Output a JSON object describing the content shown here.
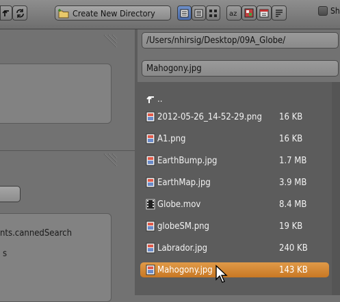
{
  "toolbar": {
    "create_dir_label": "Create New Directory",
    "show_label": "Sh",
    "icons": [
      "parent-dir-icon",
      "refresh-icon",
      "folder-new-icon",
      "short-list-icon",
      "long-list-icon",
      "thumbnail-icon",
      "sort-alpha-icon",
      "sort-ext-icon",
      "sort-time-icon",
      "sort-size-icon"
    ]
  },
  "left": {
    "search_text": "nts.cannedSearch",
    "search_text2": "s"
  },
  "path": {
    "directory": "/Users/nhirsig/Desktop/09A_Globe/",
    "filename": "Mahogony.jpg"
  },
  "files": {
    "parent_label": "..",
    "items": [
      {
        "name": "2012-05-26_14-52-29.png",
        "size": "16 KB",
        "type": "image"
      },
      {
        "name": "A1.png",
        "size": "16 KB",
        "type": "image"
      },
      {
        "name": "EarthBump.jpg",
        "size": "1.7 MB",
        "type": "image"
      },
      {
        "name": "EarthMap.jpg",
        "size": "3.9 MB",
        "type": "image"
      },
      {
        "name": "Globe.mov",
        "size": "8.4 MB",
        "type": "movie"
      },
      {
        "name": "globeSM.png",
        "size": "19 KB",
        "type": "image"
      },
      {
        "name": "Labrador.jpg",
        "size": "240 KB",
        "type": "image"
      },
      {
        "name": "Mahogony.jpg",
        "size": "143 KB",
        "type": "image",
        "selected": true
      }
    ]
  },
  "colors": {
    "selection": "#d7892f",
    "file_list_bg": "#5c5c5c",
    "panel_bg": "#727272"
  }
}
